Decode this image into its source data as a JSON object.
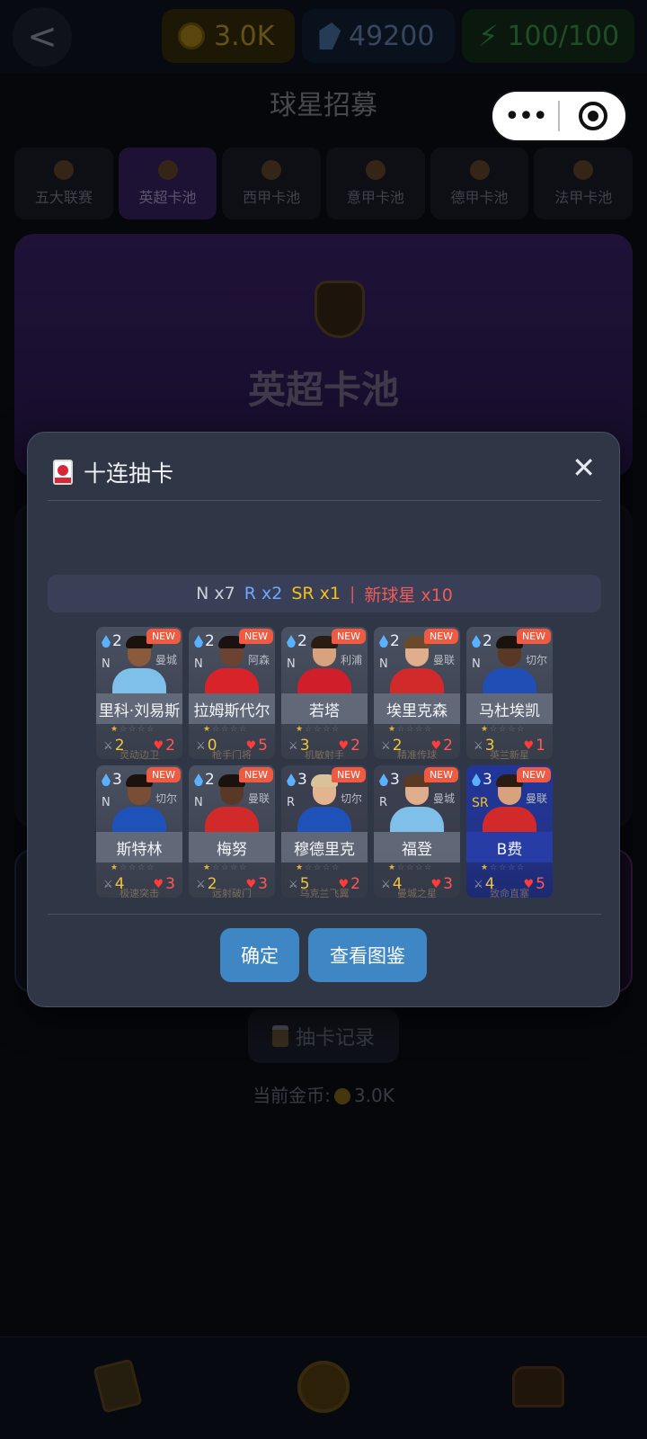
{
  "header": {
    "back_glyph": "<",
    "coins": "3.0K",
    "gems": "49200",
    "energy": "100/100",
    "title": "球星招募"
  },
  "pool_tabs": [
    {
      "label": "五大联赛",
      "active": false
    },
    {
      "label": "英超卡池",
      "active": true
    },
    {
      "label": "西甲卡池",
      "active": false
    },
    {
      "label": "意甲卡池",
      "active": false
    },
    {
      "label": "德甲卡池",
      "active": false
    },
    {
      "label": "法甲卡池",
      "active": false
    }
  ],
  "banner": {
    "title": "英超卡池"
  },
  "footer": {
    "record_label": "抽卡记录",
    "coins_label": "当前金币:",
    "coins_value": "3.0K"
  },
  "modal": {
    "title": "十连抽卡",
    "close_glyph": "✕",
    "summary": {
      "n": "N x7",
      "r": "R x2",
      "sr": "SR x1",
      "sep": "|",
      "new": "新球星 x10"
    },
    "cards": [
      {
        "cost": "2",
        "rarity": "N",
        "team": "曼城",
        "name": "里科·刘易斯",
        "atk": "2",
        "hp": "2",
        "skill": "灵动边卫",
        "new": "NEW",
        "shirt": "#7fc0ea",
        "skin": "#8a5a3c",
        "hair": "#1b120c"
      },
      {
        "cost": "2",
        "rarity": "N",
        "team": "阿森",
        "name": "拉姆斯代尔",
        "atk": "0",
        "hp": "5",
        "skill": "枪手门将",
        "new": "NEW",
        "shirt": "#d8232a",
        "skin": "#6b4330",
        "hair": "#1a1210"
      },
      {
        "cost": "2",
        "rarity": "N",
        "team": "利浦",
        "name": "若塔",
        "atk": "3",
        "hp": "2",
        "skill": "机敏射手",
        "new": "NEW",
        "shirt": "#d01f2a",
        "skin": "#d9a27e",
        "hair": "#2a1c12"
      },
      {
        "cost": "2",
        "rarity": "N",
        "team": "曼联",
        "name": "埃里克森",
        "atk": "2",
        "hp": "2",
        "skill": "精准传球",
        "new": "NEW",
        "shirt": "#d22a2a",
        "skin": "#e0ae8c",
        "hair": "#6a4a2a"
      },
      {
        "cost": "2",
        "rarity": "N",
        "team": "切尔",
        "name": "马杜埃凯",
        "atk": "3",
        "hp": "1",
        "skill": "英兰新星",
        "new": "NEW",
        "shirt": "#1f4fb5",
        "skin": "#5a3826",
        "hair": "#1a120c"
      },
      {
        "cost": "3",
        "rarity": "N",
        "team": "切尔",
        "name": "斯特林",
        "atk": "4",
        "hp": "3",
        "skill": "极速突击",
        "new": "NEW",
        "shirt": "#1f52b8",
        "skin": "#7a4e34",
        "hair": "#1a120c"
      },
      {
        "cost": "2",
        "rarity": "N",
        "team": "曼联",
        "name": "梅努",
        "atk": "2",
        "hp": "3",
        "skill": "远射破门",
        "new": "NEW",
        "shirt": "#d22a2a",
        "skin": "#5a3826",
        "hair": "#1a120c"
      },
      {
        "cost": "3",
        "rarity": "R",
        "team": "切尔",
        "name": "穆德里克",
        "atk": "5",
        "hp": "2",
        "skill": "乌克兰飞翼",
        "new": "NEW",
        "shirt": "#1f52b8",
        "skin": "#e2b490",
        "hair": "#d7c29a"
      },
      {
        "cost": "3",
        "rarity": "R",
        "team": "曼城",
        "name": "福登",
        "atk": "4",
        "hp": "3",
        "skill": "曼城之星",
        "new": "NEW",
        "shirt": "#7fc0ea",
        "skin": "#e0ae8c",
        "hair": "#5a3a22"
      },
      {
        "cost": "3",
        "rarity": "SR",
        "team": "曼联",
        "name": "B费",
        "atk": "4",
        "hp": "5",
        "skill": "致命直塞",
        "new": "NEW",
        "shirt": "#d22a2a",
        "skin": "#d9a27e",
        "hair": "#2a1c12"
      }
    ],
    "confirm_label": "确定",
    "dex_label": "查看图鉴"
  },
  "capsule": {
    "dots": "•••"
  }
}
